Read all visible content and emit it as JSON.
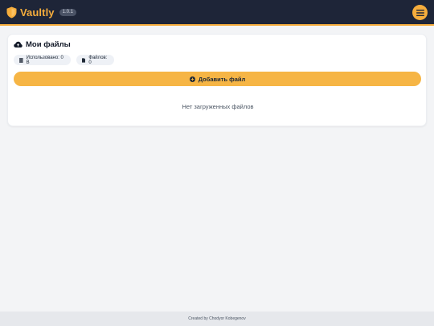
{
  "app": {
    "name": "Vaultly",
    "version": "1.0.1",
    "accent_color": "#f6ad3c",
    "header_color": "#1e2538",
    "icons": {
      "brand": "shield-icon",
      "menu": "hamburger-menu-icon"
    }
  },
  "files_card": {
    "title": "Мои файлы",
    "title_icon": "cloud-upload-icon",
    "used_chip": {
      "text": "Использовано: 0 B",
      "icon": "database-icon"
    },
    "count_chip": {
      "text": "Файлов: 0",
      "icon": "file-icon"
    },
    "add_button": {
      "label": "Добавить файл",
      "icon": "plus-circle-icon"
    },
    "empty_message": "Нет загруженных файлов"
  },
  "footer": {
    "credit": "Created by Chodyor Kobegenov"
  }
}
